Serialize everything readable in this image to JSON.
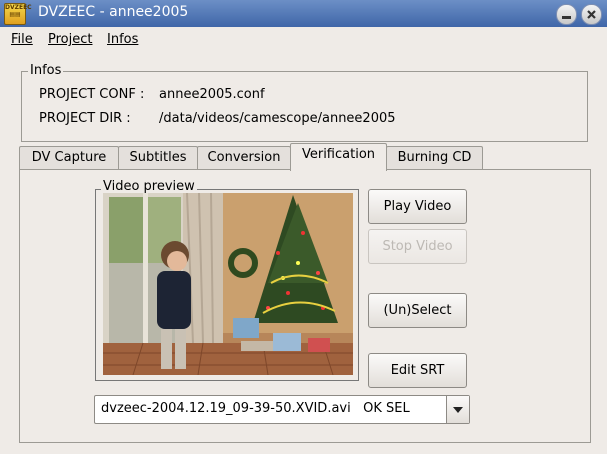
{
  "window": {
    "title": "DVZEEC - annee2005",
    "icon_text": "DVZEEC"
  },
  "menu": [
    "File",
    "Project",
    "Infos"
  ],
  "infos": {
    "group_title": "Infos",
    "conf_label": "PROJECT CONF :",
    "conf_value": "annee2005.conf",
    "dir_label": "PROJECT DIR :",
    "dir_value": "/data/videos/camescope/annee2005"
  },
  "tabs": [
    "DV Capture",
    "Subtitles",
    "Conversion",
    "Verification",
    "Burning CD"
  ],
  "active_tab": "Verification",
  "verification": {
    "preview_title": "Video preview",
    "buttons": {
      "play": "Play Video",
      "stop": "Stop Video",
      "select": "(Un)Select",
      "edit_srt": "Edit SRT"
    },
    "file_select": {
      "value": "dvzeec-2004.12.19_09-39-50.XVID.avi   OK SEL"
    }
  },
  "icons": {
    "minimize": "minimize-icon",
    "close": "close-icon",
    "dropdown": "triangle-down-icon"
  }
}
